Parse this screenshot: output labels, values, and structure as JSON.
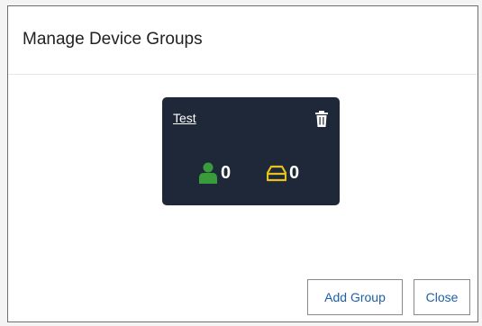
{
  "dialog": {
    "title": "Manage Device Groups"
  },
  "group_card": {
    "name": "Test",
    "users_icon": "user-icon",
    "users_count": "0",
    "devices_icon": "device-icon",
    "devices_count": "0",
    "delete_icon": "trash-icon",
    "background_color": "#1f2838",
    "users_icon_color": "#3a9b3a",
    "devices_icon_color": "#e8c21c"
  },
  "footer": {
    "add_group_label": "Add Group",
    "close_label": "Close"
  }
}
